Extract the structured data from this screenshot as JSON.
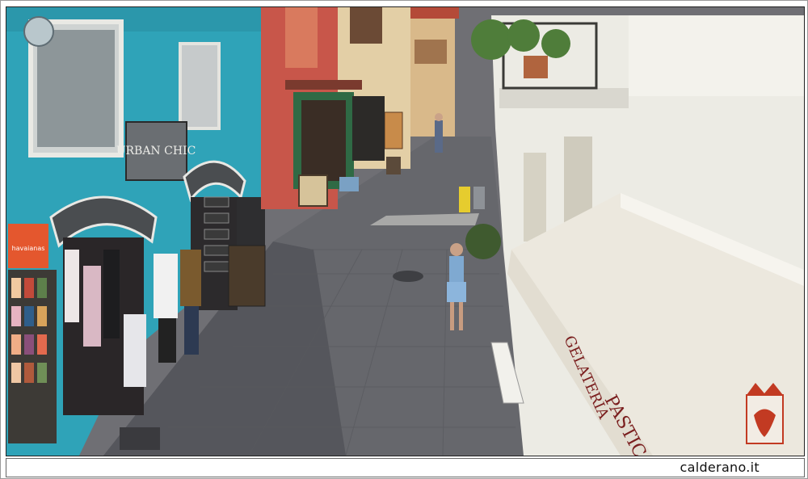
{
  "footer": {
    "caption": "calderano.it"
  },
  "signs": {
    "urban_chic": "URBAN CHIC",
    "havaianas": "havaianas",
    "gelateria": "GELATERIA",
    "pastic": "PASTIC"
  },
  "colors": {
    "building_blue": "#2fa3b8",
    "awning_cream": "#ece8de",
    "street_gray": "#6f6f74",
    "wall_red": "#c8564a",
    "logo_red": "#c23a22"
  }
}
